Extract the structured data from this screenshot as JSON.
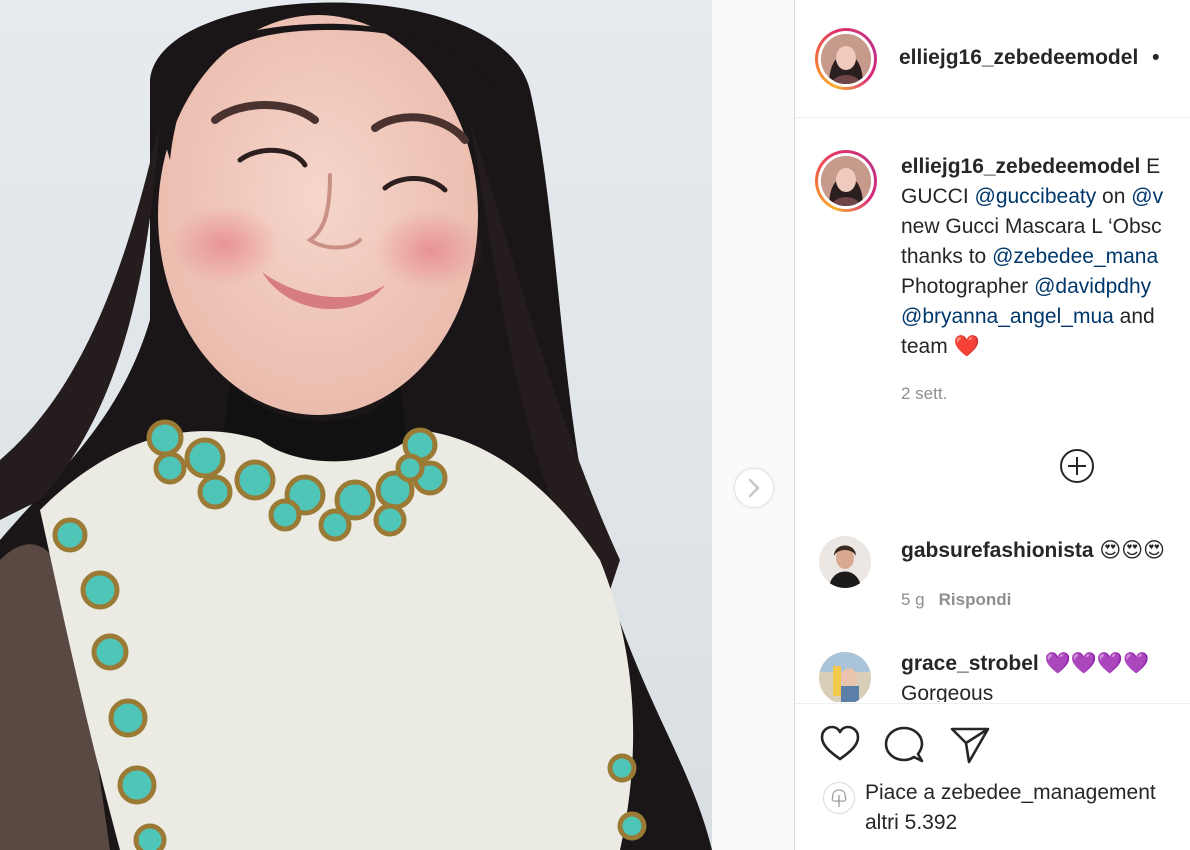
{
  "post": {
    "username": "elliejg16_zebedeemodel",
    "header_dot": "•",
    "next_icon": "chevron-right-icon"
  },
  "caption": {
    "username": "elliejg16_zebedeemodel",
    "line1_rest": " E",
    "line2_a": "GUCCI ",
    "line2_m1": "@guccibeaty",
    "line2_b": " on ",
    "line2_m2": "@v",
    "line3": "new Gucci Mascara L ‘Obsc",
    "line4_a": "thanks to ",
    "line4_m": "@zebedee_mana",
    "line5_a": "Photographer ",
    "line5_m": "@davidpdhy",
    "line6_m": "@bryanna_angel_mua",
    "line6_b": " and",
    "line7": "team ❤️",
    "time": "2 sett."
  },
  "comments": [
    {
      "username": "gabsurefashionista",
      "text": " 😍😍😍",
      "age": "5 g",
      "reply": "Rispondi"
    },
    {
      "username": "grace_strobel",
      "text": " 💜💜💜💜",
      "text2": "Gorgeous"
    }
  ],
  "actions": {
    "like_icon": "heart-icon",
    "comment_icon": "comment-bubble-icon",
    "share_icon": "paper-plane-icon",
    "more_comments_icon": "plus-circle-icon"
  },
  "likes": {
    "prefix": "Piace a ",
    "user": "zebedee_management",
    "line2": "altri 5.392"
  },
  "colors": {
    "mention": "#00376b",
    "muted": "#8e8e8e",
    "story_ring_start": "#f9b134",
    "story_ring_end": "#c13584"
  }
}
